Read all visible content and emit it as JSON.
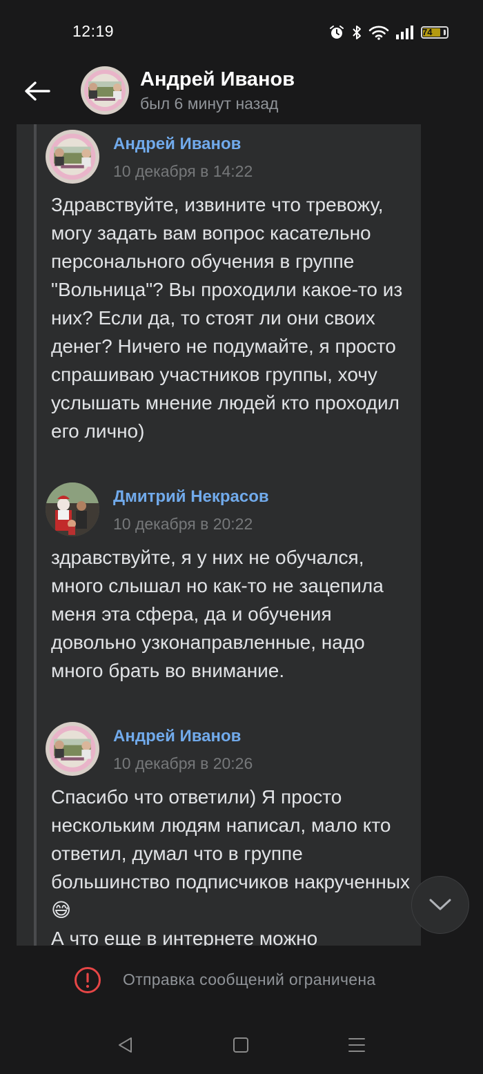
{
  "status_bar": {
    "time": "12:19",
    "battery": "74",
    "battery_level_percent": 74,
    "icons": [
      "alarm-icon",
      "bluetooth-icon",
      "wifi-icon",
      "signal-icon",
      "battery-icon"
    ]
  },
  "header": {
    "name": "Андрей Иванов",
    "status": "был 6 минут назад"
  },
  "messages": [
    {
      "author": "Андрей Иванов",
      "date": "10 декабря в 14:22",
      "text": "Здравствуйте, извините что тревожу, могу задать вам вопрос касательно персонального обучения в группе \"Вольница\"? Вы проходили какое-то из них? Если да, то стоят ли они своих денег? Ничего не подумайте, я просто спрашиваю участников группы, хочу услышать мнение людей кто проходил его лично)"
    },
    {
      "author": "Дмитрий Некрасов",
      "date": "10 декабря в 20:22",
      "text": "здравствуйте, я у них не обучался, много слышал но как-то не зацепила меня эта сфера, да и обучения довольно узконаправленные, надо много брать во внимание."
    },
    {
      "author": "Андрей Иванов",
      "date": "10 декабря в 20:26",
      "text": "Спасибо что ответили) Я просто нескольким людям написал, мало кто ответил, думал что в группе большинство подписчиков накрученных😅\nА что еще в интернете можно"
    }
  ],
  "footer": {
    "restricted_text": "Отправка сообщений ограничена"
  },
  "colors": {
    "background": "#19191a",
    "card": "#2c2d2e",
    "author_link": "#71aaeb",
    "text": "#e1e3e6",
    "muted": "#76787a",
    "alert": "#e64646"
  }
}
